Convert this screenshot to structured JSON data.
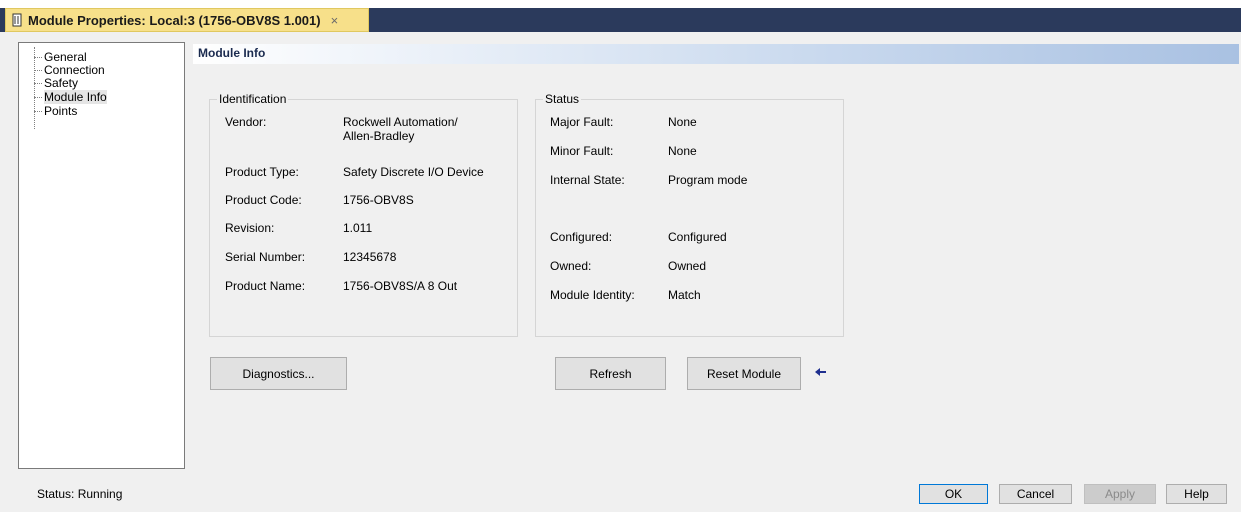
{
  "window": {
    "tab_title": "Module Properties: Local:3 (1756-OBV8S 1.001)",
    "close_glyph": "×"
  },
  "tree": {
    "items": [
      {
        "label": "General"
      },
      {
        "label": "Connection"
      },
      {
        "label": "Safety"
      },
      {
        "label": "Module Info"
      },
      {
        "label": "Points"
      }
    ],
    "selected": "Module Info"
  },
  "section": {
    "title": "Module Info"
  },
  "identification": {
    "title": "Identification",
    "rows": [
      {
        "label": "Vendor:",
        "value": "Rockwell Automation/",
        "value2": "Allen-Bradley"
      },
      {
        "label": "Product Type:",
        "value": "Safety Discrete I/O Device"
      },
      {
        "label": "Product Code:",
        "value": "1756-OBV8S"
      },
      {
        "label": "Revision:",
        "value": "1.011"
      },
      {
        "label": "Serial Number:",
        "value": "12345678"
      },
      {
        "label": "Product Name:",
        "value": "1756-OBV8S/A 8 Out"
      }
    ]
  },
  "status_group": {
    "title": "Status",
    "rows": [
      {
        "label": "Major Fault:",
        "value": "None"
      },
      {
        "label": "Minor Fault:",
        "value": "None"
      },
      {
        "label": "Internal State:",
        "value": "Program mode"
      },
      {
        "label": "Configured:",
        "value": "Configured"
      },
      {
        "label": "Owned:",
        "value": "Owned"
      },
      {
        "label": "Module Identity:",
        "value": "Match"
      }
    ]
  },
  "buttons": {
    "diagnostics": "Diagnostics...",
    "refresh": "Refresh",
    "reset_module": "Reset Module",
    "ok": "OK",
    "cancel": "Cancel",
    "apply": "Apply",
    "help": "Help"
  },
  "status_bar": {
    "text": "Status:  Running"
  },
  "colors": {
    "tab_bg": "#f7e08a",
    "title_strip": "#2b3a5c",
    "header_gradient_end": "#a9c1e2",
    "arrow": "#1f2f8f",
    "ok_border": "#0078d7"
  },
  "icons": {
    "module": "module-icon",
    "close": "close-icon",
    "arrow": "arrow-left-icon"
  }
}
